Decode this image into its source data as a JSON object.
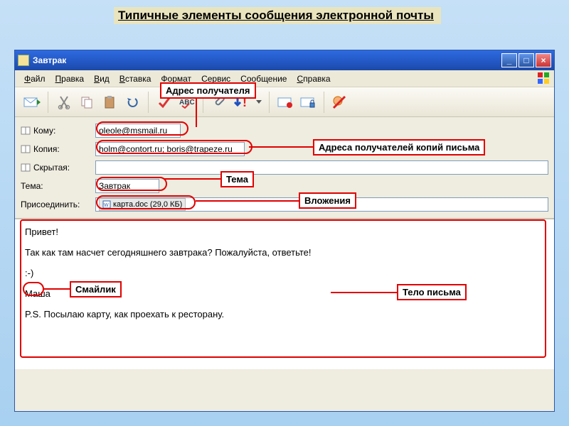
{
  "slide_title": "Типичные элементы сообщения электронной почты",
  "window": {
    "title": "Завтрак"
  },
  "menu": {
    "file": "Файл",
    "edit": "Правка",
    "view": "Вид",
    "insert": "Вставка",
    "format": "Формат",
    "tools": "Сервис",
    "message": "Сообщение",
    "help": "Справка"
  },
  "header": {
    "to_label": "Кому:",
    "to_value": "oleole@msmail.ru",
    "cc_label": "Копия:",
    "cc_value": "holm@contort.ru; boris@trapeze.ru",
    "bcc_label": "Скрытая:",
    "bcc_value": "",
    "subject_label": "Тема:",
    "subject_value": "Завтрак",
    "attach_label": "Присоединить:",
    "attach_value": "карта.doc (29,0 КБ)"
  },
  "body": {
    "l1": "Привет!",
    "l2": "Так как там насчет сегодняшнего завтрака? Пожалуйста, ответьте!",
    "l3": ":-)",
    "l4": "Маша",
    "l5": "P.S. Посылаю карту, как проехать к ресторану."
  },
  "callouts": {
    "recipient": "Адрес получателя",
    "cc": "Адреса получателей копий письма",
    "subject": "Тема",
    "attach": "Вложения",
    "smiley": "Смайлик",
    "bodylabel": "Тело письма"
  }
}
